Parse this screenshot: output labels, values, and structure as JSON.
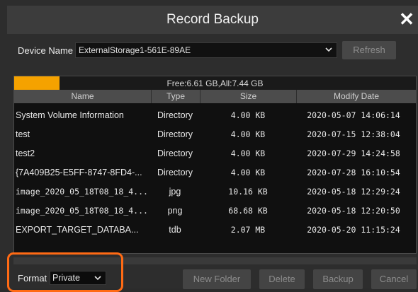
{
  "window": {
    "title": "Record Backup"
  },
  "device": {
    "label": "Device Name",
    "selected": "ExternalStorage1-561E-89AE",
    "refresh_label": "Refresh"
  },
  "storage": {
    "text": "Free:6.61 GB,All:7.44 GB",
    "used_fraction": 0.112,
    "bar_color": "#f5a200"
  },
  "table": {
    "columns": [
      "Name",
      "Type",
      "Size",
      "Modify Date"
    ],
    "rows": [
      {
        "name": "System Volume Information",
        "type": "Directory",
        "size": "4.00 KB",
        "date": "2020-05-07 14:06:14"
      },
      {
        "name": "test",
        "type": "Directory",
        "size": "4.00 KB",
        "date": "2020-07-15 12:38:04"
      },
      {
        "name": "test2",
        "type": "Directory",
        "size": "4.00 KB",
        "date": "2020-07-29 14:24:58"
      },
      {
        "name": "{7A409B25-E5FF-8747-8FD4-...",
        "type": "Directory",
        "size": "4.00 KB",
        "date": "2020-07-28 16:10:54"
      },
      {
        "name": "image_2020_05_18T08_18_4...",
        "type": "jpg",
        "size": "10.16 KB",
        "date": "2020-05-18 12:29:24"
      },
      {
        "name": "image_2020_05_18T08_18_4...",
        "type": "png",
        "size": "68.68 KB",
        "date": "2020-05-18 12:20:50"
      },
      {
        "name": "EXPORT_TARGET_DATABA...",
        "type": "tdb",
        "size": "2.07 MB",
        "date": "2020-05-20 11:15:24"
      }
    ]
  },
  "footer": {
    "format_label": "Format",
    "format_selected": "Private",
    "buttons": {
      "new_folder": "New Folder",
      "delete": "Delete",
      "backup": "Backup",
      "cancel": "Cancel"
    }
  },
  "icons": {
    "close": "close-icon",
    "dropdown": "chevron-down-icon"
  },
  "colors": {
    "highlight": "#ff6a14",
    "accent": "#f5a200"
  }
}
